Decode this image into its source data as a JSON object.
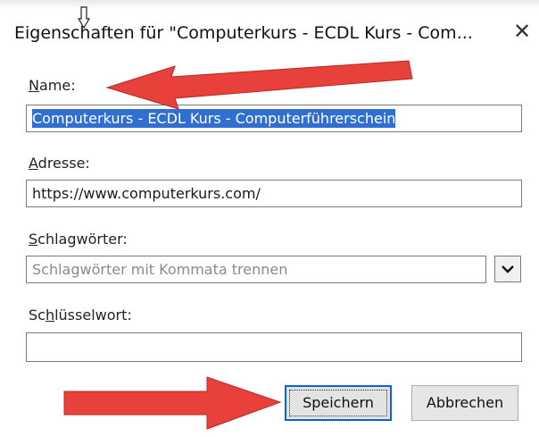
{
  "dialog": {
    "title": "Eigenschaften für \"Computerkurs - ECDL Kurs - Com...",
    "close_glyph": "✕"
  },
  "fields": {
    "name": {
      "label_accel": "N",
      "label_rest": "ame:",
      "value": "Computerkurs - ECDL Kurs - Computerführerschein"
    },
    "address": {
      "label_accel": "A",
      "label_rest": "dresse:",
      "value": "https://www.computerkurs.com/"
    },
    "tags": {
      "label_accel": "S",
      "label_rest": "chlagwörter:",
      "placeholder": "Schlagwörter mit Kommata trennen"
    },
    "keyword": {
      "label_pre": "Sc",
      "label_accel": "h",
      "label_rest": "lüsselwort:",
      "value": ""
    }
  },
  "buttons": {
    "save": "Speichern",
    "cancel": "Abbrechen"
  },
  "colors": {
    "annotation_arrow": "#e8413c",
    "selection": "#2f6fd1",
    "focus_border": "#0a64d6"
  },
  "icons": {
    "dropdown": "chevron-down-icon",
    "close": "close-icon",
    "cursor": "mouse-cursor-icon"
  }
}
